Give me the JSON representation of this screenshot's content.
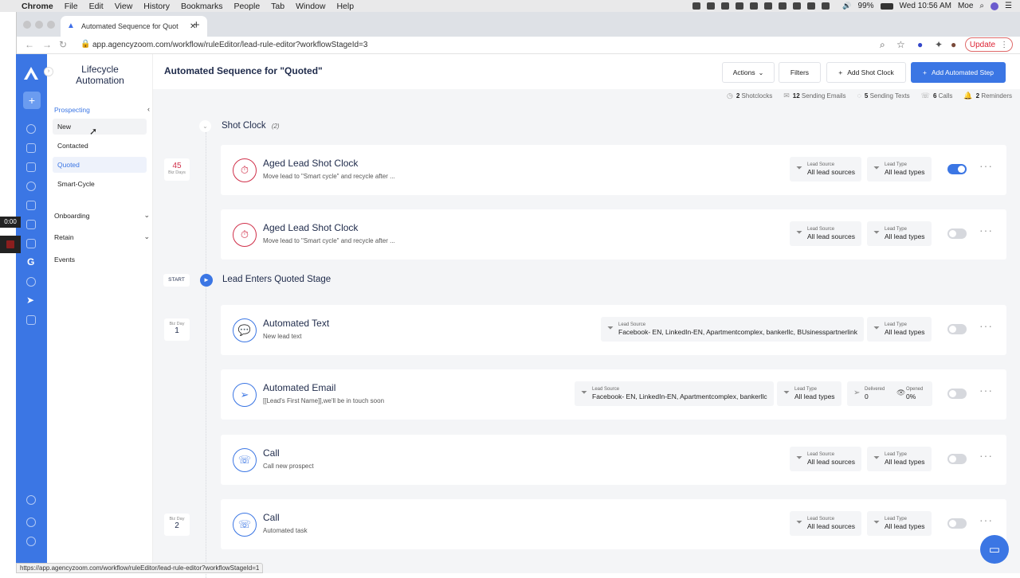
{
  "menubar": {
    "app": "Chrome",
    "items": [
      "File",
      "Edit",
      "View",
      "History",
      "Bookmarks",
      "People",
      "Tab",
      "Window",
      "Help"
    ],
    "battery": "99%",
    "clock": "Wed 10:56 AM",
    "user": "Moe"
  },
  "browser": {
    "tab_title": "Automated Sequence for Quot",
    "url": "app.agencyzoom.com/workflow/ruleEditor/lead-rule-editor?workflowStageId=3",
    "update_label": "Update",
    "status_url": "https://app.agencyzoom.com/workflow/ruleEditor/lead-rule-editor?workflowStageId=1"
  },
  "recorder": {
    "time": "0:00"
  },
  "sidebar": {
    "title_line1": "Lifecycle",
    "title_line2": "Automation",
    "prospecting": "Prospecting",
    "items": [
      {
        "label": "New"
      },
      {
        "label": "Contacted"
      },
      {
        "label": "Quoted"
      },
      {
        "label": "Smart-Cycle"
      }
    ],
    "onboarding": "Onboarding",
    "retain": "Retain",
    "events": "Events"
  },
  "header": {
    "title": "Automated Sequence for \"Quoted\"",
    "actions": "Actions",
    "filters": "Filters",
    "add_shot_clock": "Add Shot Clock",
    "add_step": "Add Automated Step"
  },
  "stats": {
    "shotclocks_n": "2",
    "shotclocks": "Shotclocks",
    "emails_n": "12",
    "emails": "Sending Emails",
    "texts_n": "5",
    "texts": "Sending Texts",
    "calls_n": "6",
    "calls": "Calls",
    "reminders_n": "2",
    "reminders": "Reminders"
  },
  "shotclock": {
    "label": "Shot Clock",
    "count": "(2)"
  },
  "start": {
    "badge": "START",
    "label": "Lead Enters Quoted Stage"
  },
  "days": {
    "d45_num": "45",
    "d45_label": "Biz Days",
    "d1_label": "Biz Day",
    "d1_num": "1",
    "d2_label": "Biz Day",
    "d2_num": "2"
  },
  "cards": [
    {
      "title": "Aged Lead Shot Clock",
      "sub": "Move lead to \"Smart cycle\" and recycle after ...",
      "src_label": "Lead Source",
      "src": "All lead sources",
      "type_label": "Lead Type",
      "type": "All lead types",
      "enabled": true
    },
    {
      "title": "Aged Lead Shot Clock",
      "sub": "Move lead to \"Smart cycle\" and recycle after ...",
      "src_label": "Lead Source",
      "src": "All lead sources",
      "type_label": "Lead Type",
      "type": "All lead types",
      "enabled": false
    },
    {
      "title": "Automated Text",
      "sub": "New lead text",
      "src_label": "Lead Source",
      "src": "Facebook- EN, LinkedIn-EN, Apartmentcomplex, bankerllc, BUsinesspartnerlink",
      "type_label": "Lead Type",
      "type": "All lead types",
      "enabled": false
    },
    {
      "title": "Automated Email",
      "sub": "[[Lead's First Name]],we'll be in touch soon",
      "src_label": "Lead Source",
      "src": "Facebook- EN, LinkedIn-EN, Apartmentcomplex, bankerllc",
      "type_label": "Lead Type",
      "type": "All lead types",
      "delivered_label": "Delivered",
      "delivered": "0",
      "opened_label": "Opened",
      "opened": "0%",
      "enabled": false
    },
    {
      "title": "Call",
      "sub": "Call new prospect",
      "src_label": "Lead Source",
      "src": "All lead sources",
      "type_label": "Lead Type",
      "type": "All lead types",
      "enabled": false
    },
    {
      "title": "Call",
      "sub": "Automated task",
      "src_label": "Lead Source",
      "src": "All lead sources",
      "type_label": "Lead Type",
      "type": "All lead types",
      "enabled": false
    }
  ],
  "colors": {
    "accent": "#3b76e4",
    "shotclock": "#d0304a",
    "rail": "#3b76e4"
  }
}
